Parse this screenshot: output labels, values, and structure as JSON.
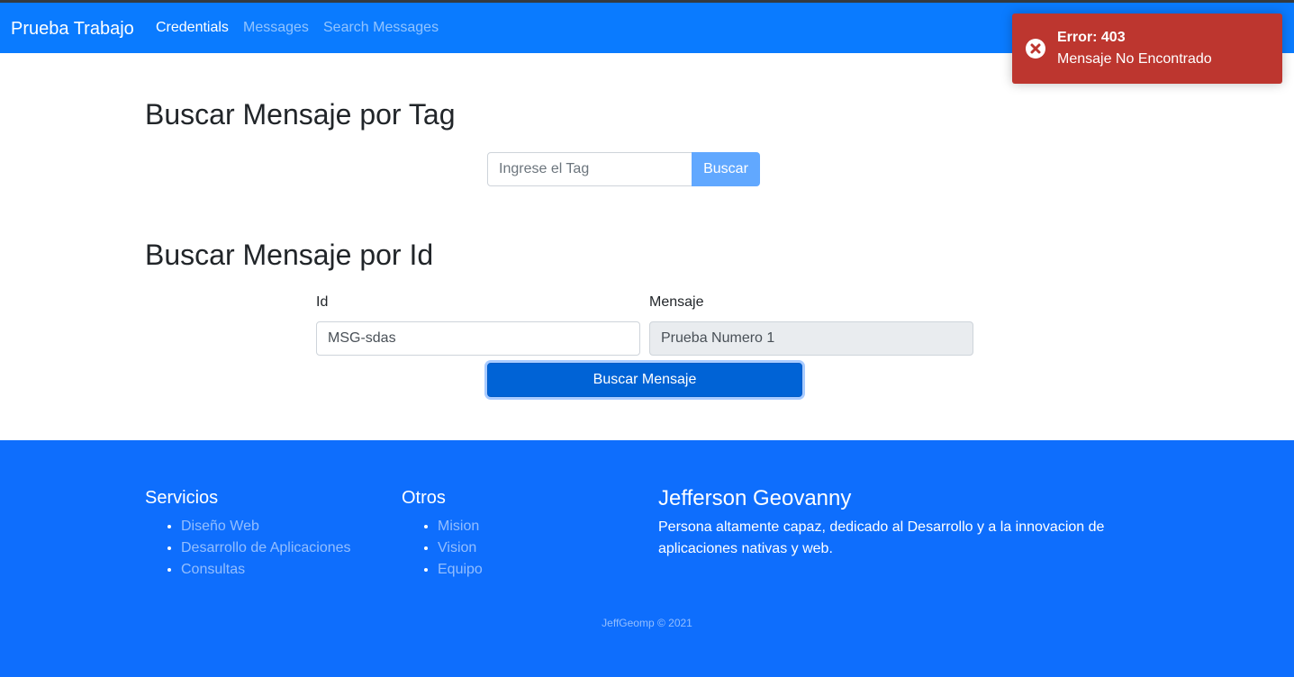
{
  "navbar": {
    "brand": "Prueba Trabajo",
    "links": [
      "Credentials",
      "Messages",
      "Search Messages"
    ]
  },
  "search_tag": {
    "title": "Buscar Mensaje por Tag",
    "placeholder": "Ingrese el Tag",
    "button": "Buscar"
  },
  "search_id": {
    "title": "Buscar Mensaje por Id",
    "id_label": "Id",
    "id_value": "MSG-sdas",
    "message_label": "Mensaje",
    "message_value": "Prueba Numero 1",
    "button": "Buscar Mensaje"
  },
  "footer": {
    "services_title": "Servicios",
    "services": [
      "Diseño Web",
      "Desarrollo de Aplicaciones",
      "Consultas"
    ],
    "others_title": "Otros",
    "others": [
      "Mision",
      "Vision",
      "Equipo"
    ],
    "author_name": "Jefferson Geovanny",
    "author_desc": "Persona altamente capaz, dedicado al Desarrollo y a la innovacion de aplicaciones nativas y web.",
    "copyright": "JeffGeomp © 2021"
  },
  "toast": {
    "title": "Error: 403",
    "message": "Mensaje No Encontrado",
    "icon": "error-circle-icon"
  },
  "colors": {
    "navbar": "#0a7bff",
    "footer": "#0e6efd",
    "toast": "#bd362f",
    "primary_button": "#0063d6"
  }
}
